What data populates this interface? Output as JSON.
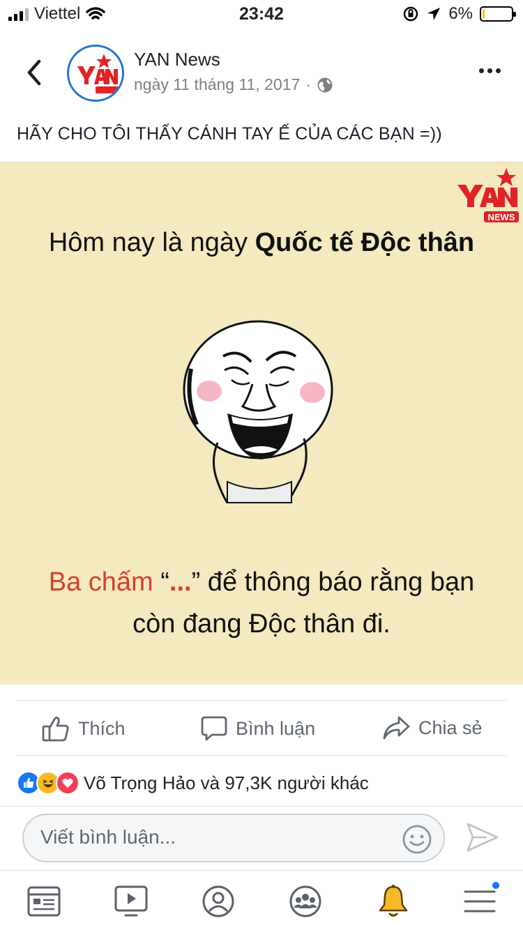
{
  "status_bar": {
    "carrier": "Viettel",
    "time": "23:42",
    "battery": "6%",
    "battery_level": 0.06
  },
  "post": {
    "page_name": "YAN News",
    "date": "ngày 11 tháng 11, 2017",
    "separator": "·",
    "caption": "HÃY CHO TÔI THẤY CÁNH TAY Ế CỦA CÁC BẠN =))",
    "image": {
      "headline_prefix": "Hôm nay là ngày ",
      "headline_bold": "Quốc tế Độc thân",
      "line1_red": "Ba chấm",
      "line1_open_quote": " “",
      "line1_dots": "...",
      "line1_close": "” để thông báo rằng bạn",
      "line2": "còn đang Độc thân đi."
    }
  },
  "actions": {
    "like": "Thích",
    "comment": "Bình luận",
    "share": "Chia sẻ"
  },
  "reactions": {
    "summary": "Võ Trọng Hảo và 97,3K người khác",
    "types": [
      "like-icon",
      "haha-icon",
      "love-icon"
    ]
  },
  "comment": {
    "placeholder": "Viết bình luận..."
  },
  "bottom_nav": {
    "items": [
      "news-feed-icon",
      "watch-icon",
      "profile-icon",
      "groups-icon",
      "notifications-icon",
      "menu-icon"
    ]
  },
  "colors": {
    "accent": "#1877f2",
    "image_background": "#f4e9bf",
    "red_text": "#d9402d"
  }
}
